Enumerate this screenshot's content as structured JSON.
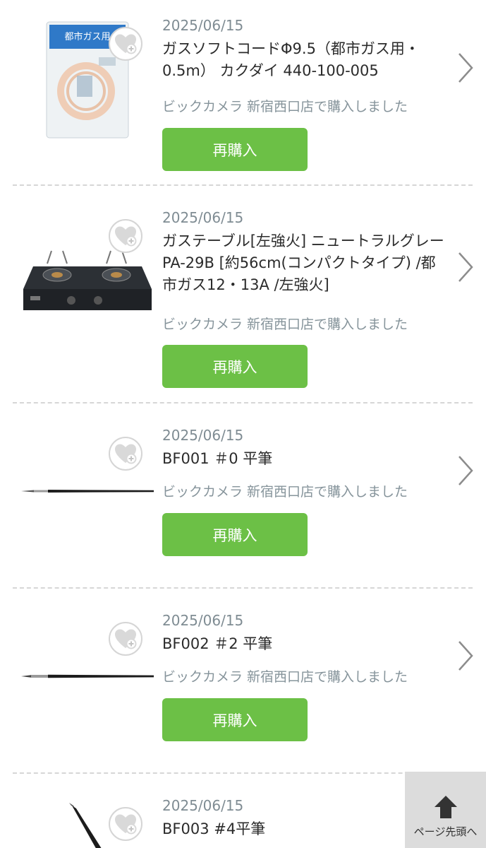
{
  "items": [
    {
      "date": "2025/06/15",
      "title": "ガスソフトコードΦ9.5（都市ガス用・0.5m） カクダイ 440-100-005",
      "shop": "ビックカメラ 新宿西口店で購入しました",
      "rebuy_label": "再購入",
      "image_icon": "gas-hose-package",
      "package_text": "都市ガス用"
    },
    {
      "date": "2025/06/15",
      "title": "ガステーブル[左強火] ニュートラルグレー PA-29B [約56cm(コンパクトタイプ) /都市ガス12・13A /左強火]",
      "shop": "ビックカメラ 新宿西口店で購入しました",
      "rebuy_label": "再購入",
      "image_icon": "gas-stove"
    },
    {
      "date": "2025/06/15",
      "title": "BF001 ＃0 平筆",
      "shop": "ビックカメラ 新宿西口店で購入しました",
      "rebuy_label": "再購入",
      "image_icon": "brush"
    },
    {
      "date": "2025/06/15",
      "title": "BF002 ＃2 平筆",
      "shop": "ビックカメラ 新宿西口店で購入しました",
      "rebuy_label": "再購入",
      "image_icon": "brush"
    },
    {
      "date": "2025/06/15",
      "title": "BF003 #4平筆",
      "image_icon": "brush"
    }
  ],
  "back_to_top": {
    "label": "ページ先頭へ",
    "icon": "arrow-up-icon"
  },
  "colors": {
    "rebuy_button": "#6cc046",
    "muted_text": "#86949b",
    "divider": "#d6d6d6"
  }
}
